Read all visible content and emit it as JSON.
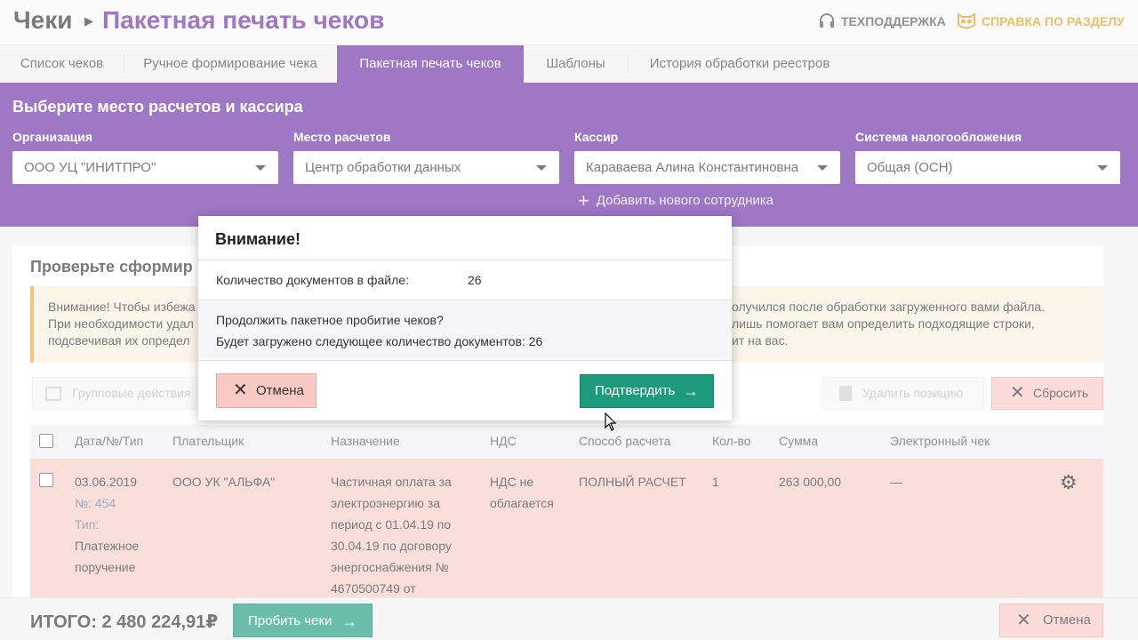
{
  "header": {
    "breadcrumb_root": "Чеки",
    "breadcrumb_sep": "▶",
    "page_title": "Пакетная печать чеков",
    "support_label": "ТЕХПОДДЕРЖКА",
    "help_label": "СПРАВКА ПО РАЗДЕЛУ"
  },
  "tabs": [
    {
      "label": "Список чеков"
    },
    {
      "label": "Ручное формирование чека"
    },
    {
      "label": "Пакетная печать чеков",
      "active": true
    },
    {
      "label": "Шаблоны"
    },
    {
      "label": "История обработки реестров"
    }
  ],
  "selection": {
    "title": "Выберите место расчетов и кассира",
    "fields": [
      {
        "label": "Организация",
        "value": "ООО УЦ \"ИНИТПРО\""
      },
      {
        "label": "Место расчетов",
        "value": "Центр обработки данных"
      },
      {
        "label": "Кассир",
        "value": "Караваева Алина Константиновна"
      },
      {
        "label": "Система налогообложения",
        "value": "Общая (ОСН)"
      }
    ],
    "add_employee": "Добавить нового сотрудника"
  },
  "content": {
    "title": "Проверьте сформир",
    "warning_left": [
      "Внимание! Чтобы избежа",
      "При необходимости удал",
      "подсвечивая их определ"
    ],
    "warning_right": [
      "олучился после обработки загруженного вами файла.",
      "лишь помогает вам определить подходящие строки,",
      "ит на вас."
    ],
    "group_actions": "Групповые действия",
    "delete_position": "Удалить позицию",
    "reset": "Сбросить",
    "columns": [
      "Дата/№/Тип",
      "Плательщик",
      "Назначение",
      "НДС",
      "Способ расчета",
      "Кол-во",
      "Сумма",
      "Электронный чек"
    ],
    "row": {
      "date": "03.06.2019",
      "num_label": "№:",
      "num": "454",
      "type_label": "Тип:",
      "type_lines": [
        "Платежное",
        "поручение"
      ],
      "payer": "ООО УК \"АЛЬФА\"",
      "purpose_lines": [
        "Частичная оплата за",
        "электроэнергию за",
        "период с 01.04.19 по",
        "30.04.19 по договору",
        "энергоснабжения №",
        "4670500749 от"
      ],
      "vat_lines": [
        "НДС не",
        "облагается"
      ],
      "payment_method": "ПОЛНЫЙ РАСЧЕТ",
      "qty": "1",
      "amount": "263 000,00",
      "e_receipt": "—"
    }
  },
  "footer": {
    "total": "ИТОГО: 2 480 224,91₽",
    "print_button": "Пробить чеки",
    "cancel_button": "Отмена"
  },
  "modal": {
    "title": "Внимание!",
    "count_label": "Количество документов в файле:",
    "count_value": "26",
    "question": "Продолжить пакетное пробитие чеков?",
    "info": "Будет загружено следующее количество документов: 26",
    "cancel": "Отмена",
    "confirm": "Подтвердить"
  },
  "colors": {
    "brand_purple": "#6a2fa6",
    "confirm_green": "#1d9b7c",
    "cancel_pink": "#f9c9c4",
    "help_orange": "#e49b1a"
  }
}
